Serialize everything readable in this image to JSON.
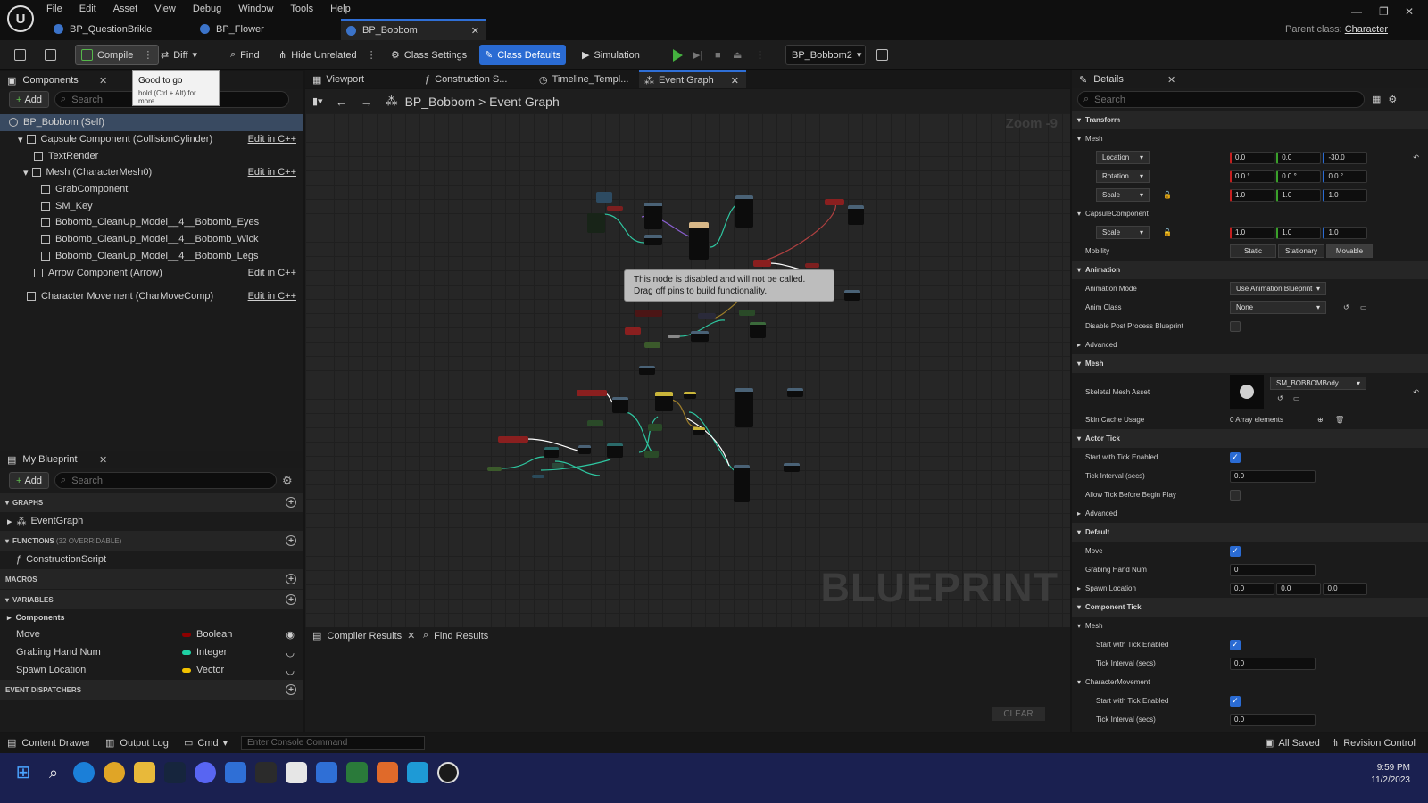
{
  "menu": [
    "File",
    "Edit",
    "Asset",
    "View",
    "Debug",
    "Window",
    "Tools",
    "Help"
  ],
  "doc_tabs": [
    "BP_QuestionBrikle",
    "BP_Flower",
    "BP_Bobbom"
  ],
  "parent_class": {
    "label": "Parent class:",
    "value": "Character"
  },
  "toolbar": {
    "compile": "Compile",
    "diff": "Diff",
    "find": "Find",
    "hide_unrelated": "Hide Unrelated",
    "class_settings": "Class Settings",
    "class_defaults": "Class Defaults",
    "simulation": "Simulation",
    "debug_object": "BP_Bobbom2"
  },
  "tooltip": {
    "title": "Good to go",
    "hint": "hold (Ctrl + Alt) for more"
  },
  "components": {
    "title": "Components",
    "add": "Add",
    "search_placeholder": "Search",
    "items": [
      {
        "label": "BP_Bobbom (Self)",
        "edit": ""
      },
      {
        "label": "Capsule Component (CollisionCylinder)",
        "edit": "Edit in C++"
      },
      {
        "label": "TextRender",
        "edit": ""
      },
      {
        "label": "Mesh (CharacterMesh0)",
        "edit": "Edit in C++"
      },
      {
        "label": "GrabComponent",
        "edit": ""
      },
      {
        "label": "SM_Key",
        "edit": ""
      },
      {
        "label": "Bobomb_CleanUp_Model__4__Bobomb_Eyes",
        "edit": ""
      },
      {
        "label": "Bobomb_CleanUp_Model__4__Bobomb_Wick",
        "edit": ""
      },
      {
        "label": "Bobomb_CleanUp_Model__4__Bobomb_Legs",
        "edit": ""
      },
      {
        "label": "Arrow Component (Arrow)",
        "edit": "Edit in C++"
      },
      {
        "label": "Character Movement (CharMoveComp)",
        "edit": "Edit in C++"
      }
    ]
  },
  "my_blueprint": {
    "title": "My Blueprint",
    "add": "Add",
    "search_placeholder": "Search",
    "graphs_label": "GRAPHS",
    "graph_item": "EventGraph",
    "functions_label": "FUNCTIONS",
    "functions_count": "(32 OVERRIDABLE)",
    "function_item": "ConstructionScript",
    "macros_label": "MACROS",
    "variables_label": "VARIABLES",
    "components_group": "Components",
    "variables": [
      {
        "name": "Move",
        "type": "Boolean",
        "color": "#8e0000"
      },
      {
        "name": "Grabing Hand Num",
        "type": "Integer",
        "color": "#1fd1a4"
      },
      {
        "name": "Spawn Location",
        "type": "Vector",
        "color": "#f2c200"
      }
    ],
    "dispatchers_label": "EVENT DISPATCHERS"
  },
  "center_tabs": [
    "Viewport",
    "Construction S...",
    "Timeline_Templ...",
    "Event Graph"
  ],
  "graph": {
    "breadcrumb_bp": "BP_Bobbom",
    "breadcrumb_sep": ">",
    "breadcrumb_graph": "Event Graph",
    "zoom": "Zoom -9",
    "watermark": "BLUEPRINT",
    "disabled_line1": "This node is disabled and will not be called.",
    "disabled_line2": "Drag off pins to build functionality."
  },
  "bottom_tabs": {
    "compiler": "Compiler Results",
    "find": "Find Results",
    "clear": "CLEAR"
  },
  "details": {
    "title": "Details",
    "search_placeholder": "Search",
    "transform": "Transform",
    "mesh": "Mesh",
    "location": {
      "label": "Location",
      "x": "0.0",
      "y": "0.0",
      "z": "-30.0"
    },
    "rotation": {
      "label": "Rotation",
      "x": "0.0 °",
      "y": "0.0 °",
      "z": "0.0 °"
    },
    "scale": {
      "label": "Scale",
      "x": "1.0",
      "y": "1.0",
      "z": "1.0"
    },
    "capsule": "CapsuleComponent",
    "capsule_scale": {
      "label": "Scale",
      "x": "1.0",
      "y": "1.0",
      "z": "1.0"
    },
    "mobility": {
      "label": "Mobility",
      "opts": [
        "Static",
        "Stationary",
        "Movable"
      ]
    },
    "animation": "Animation",
    "anim_mode": {
      "label": "Animation Mode",
      "value": "Use Animation Blueprint"
    },
    "anim_class": {
      "label": "Anim Class",
      "value": "None"
    },
    "disable_post": "Disable Post Process Blueprint",
    "advanced": "Advanced",
    "mesh_sec": "Mesh",
    "skel_mesh": {
      "label": "Skeletal Mesh Asset",
      "value": "SM_BOBBOMBody"
    },
    "skin_cache": {
      "label": "Skin Cache Usage",
      "value": "0 Array elements"
    },
    "actor_tick": "Actor Tick",
    "start_tick": "Start with Tick Enabled",
    "tick_interval": {
      "label": "Tick Interval (secs)",
      "value": "0.0"
    },
    "allow_tick": "Allow Tick Before Begin Play",
    "default": "Default",
    "move": "Move",
    "grab_num": {
      "label": "Grabing Hand Num",
      "value": "0"
    },
    "spawn": {
      "label": "Spawn Location",
      "x": "0.0",
      "y": "0.0",
      "z": "0.0"
    },
    "comp_tick": "Component Tick",
    "ct_mesh": "Mesh",
    "ct_start": "Start with Tick Enabled",
    "ct_interval": {
      "label": "Tick Interval (secs)",
      "value": "0.0"
    },
    "ct_charmove": "CharacterMovement",
    "cm_start": "Start with Tick Enabled",
    "cm_interval": {
      "label": "Tick Interval (secs)",
      "value": "0.0"
    }
  },
  "status": {
    "content_drawer": "Content Drawer",
    "output_log": "Output Log",
    "cmd": "Cmd",
    "console_placeholder": "Enter Console Command",
    "all_saved": "All Saved",
    "revision": "Revision Control"
  },
  "clock": {
    "time": "9:59 PM",
    "date": "11/2/2023"
  }
}
